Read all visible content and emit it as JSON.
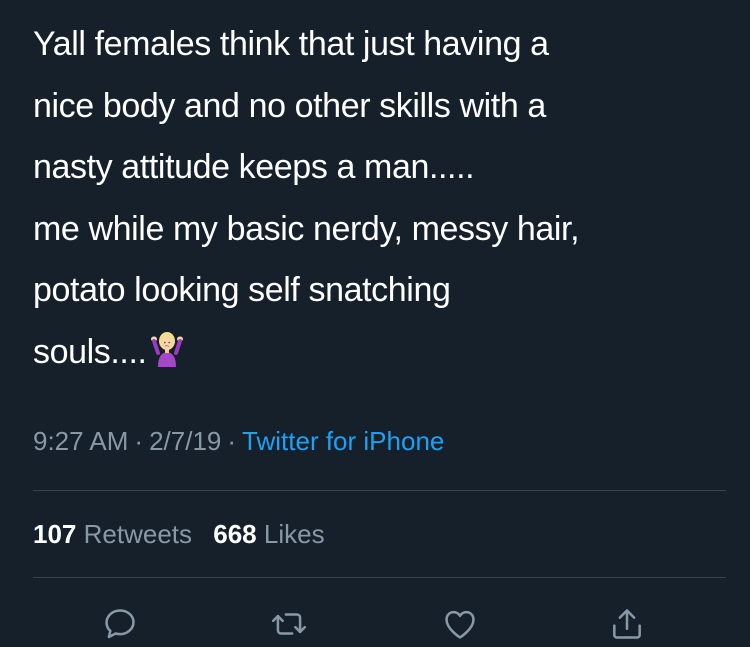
{
  "tweet": {
    "lines": [
      "Yall females think that just having a",
      "nice body and no other skills with a",
      "nasty attitude keeps a man.....",
      "me while my basic nerdy, messy hair,",
      "potato looking self snatching",
      "souls...."
    ],
    "emoji": "shrug-emoji"
  },
  "meta": {
    "time": "9:27 AM",
    "separator": "·",
    "date": "2/7/19",
    "source": "Twitter for iPhone"
  },
  "stats": {
    "retweets_count": "107",
    "retweets_label": "Retweets",
    "likes_count": "668",
    "likes_label": "Likes"
  },
  "actions": {
    "icons": [
      "reply-icon",
      "retweet-icon",
      "like-icon",
      "share-icon"
    ]
  },
  "colors": {
    "background": "#15202b",
    "text": "#ffffff",
    "secondary": "#8899a6",
    "accent": "#1da1f2",
    "divider": "#38444d"
  }
}
